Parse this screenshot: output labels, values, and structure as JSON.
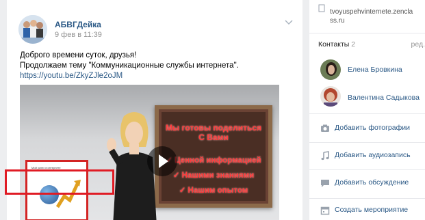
{
  "post": {
    "author": "АБВГДейка",
    "date": "9 фев в 11:39",
    "text_line1": "Доброго времени суток, друзья!",
    "text_line2": "Продолжаем тему \"Коммуникационные службы интернета\".",
    "link": "https://youtu.be/ZkyZJle2oJM",
    "video": {
      "board_title_1": "Мы готовы поделиться",
      "board_title_2": "С Вами",
      "item1": "✓ Ценной информацией",
      "item2": "✓ Нашими знаниями",
      "item3": "✓ Нашим опытом",
      "sign_caption": "Мой успех в интернете"
    }
  },
  "sidebar": {
    "site": "tvoyuspehvinternete.zencla ss.ru",
    "contacts_label": "Контакты",
    "contacts_count": "2",
    "edit_label": "ред.",
    "contacts": [
      {
        "name": "Елена Бровкина"
      },
      {
        "name": "Валентина Садыкова"
      }
    ],
    "actions": [
      {
        "label": "Добавить фотографии",
        "icon": "camera-icon"
      },
      {
        "label": "Добавить аудиозапись",
        "icon": "music-note-icon"
      },
      {
        "label": "Добавить обсуждение",
        "icon": "chat-bubble-icon"
      },
      {
        "label": "Создать мероприятие",
        "icon": "calendar-icon"
      }
    ],
    "highlight_color": "#e01b24"
  },
  "colors": {
    "link": "#2a5885",
    "muted": "#939393",
    "page_bg": "#edeef0"
  }
}
